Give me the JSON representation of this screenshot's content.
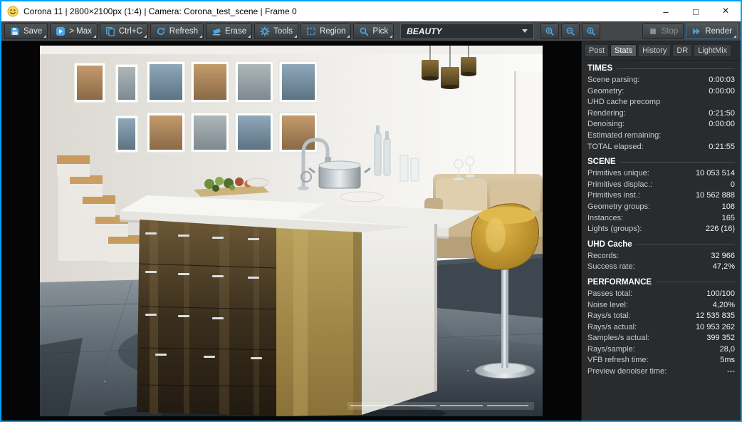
{
  "window": {
    "title": "Corona 11 | 2800×2100px (1:4) | Camera: Corona_test_scene | Frame 0",
    "controls": {
      "minimize": "–",
      "maximize": "□",
      "close": "×"
    }
  },
  "toolbar": {
    "buttons": [
      {
        "name": "save",
        "icon": "save-icon",
        "label": "Save",
        "dropdown": true
      },
      {
        "name": "to-max",
        "icon": "to-max-icon",
        "label": "> Max",
        "dropdown": true
      },
      {
        "name": "copy",
        "icon": "copy-icon",
        "label": "Ctrl+C",
        "dropdown": true
      },
      {
        "name": "refresh",
        "icon": "refresh-icon",
        "label": "Refresh",
        "dropdown": true
      },
      {
        "name": "erase",
        "icon": "erase-icon",
        "label": "Erase",
        "dropdown": true
      },
      {
        "name": "tools",
        "icon": "gear-icon",
        "label": "Tools",
        "dropdown": true
      },
      {
        "name": "region",
        "icon": "region-icon",
        "label": "Region",
        "dropdown": true
      },
      {
        "name": "pick",
        "icon": "pick-icon",
        "label": "Pick",
        "dropdown": true
      }
    ],
    "channel_select": {
      "value": "BEAUTY"
    },
    "zoom_buttons": [
      {
        "name": "zoom-in",
        "icon": "zoom-in-icon"
      },
      {
        "name": "zoom-out",
        "icon": "zoom-out-icon"
      },
      {
        "name": "zoom-reset",
        "icon": "zoom-reset-icon"
      }
    ],
    "stop": {
      "label": "Stop"
    },
    "render": {
      "label": "Render"
    }
  },
  "side_panel": {
    "tabs": [
      "Post",
      "Stats",
      "History",
      "DR",
      "LightMix"
    ],
    "active_tab": "Stats",
    "stats_sections": [
      {
        "title": "TIMES",
        "rows": [
          {
            "label": "Scene parsing:",
            "value": "0:00:03"
          },
          {
            "label": "Geometry:",
            "value": "0:00:00"
          },
          {
            "label": "UHD cache precomp",
            "value": ""
          },
          {
            "label": "Rendering:",
            "value": "0:21:50"
          },
          {
            "label": "Denoising:",
            "value": "0:00:00"
          },
          {
            "label": "Estimated remaining:",
            "value": ""
          },
          {
            "label": "TOTAL elapsed:",
            "value": "0:21:55"
          }
        ]
      },
      {
        "title": "SCENE",
        "rows": [
          {
            "label": "Primitives unique:",
            "value": "10 053 514"
          },
          {
            "label": "Primitives displac.:",
            "value": "0"
          },
          {
            "label": "Primitives inst.:",
            "value": "10 562 888"
          },
          {
            "label": "Geometry groups:",
            "value": "108"
          },
          {
            "label": "Instances:",
            "value": "165"
          },
          {
            "label": "Lights (groups):",
            "value": "226 (16)"
          }
        ]
      },
      {
        "title": "UHD Cache",
        "rows": [
          {
            "label": "Records:",
            "value": "32 966"
          },
          {
            "label": "Success rate:",
            "value": "47,2%"
          }
        ]
      },
      {
        "title": "PERFORMANCE",
        "rows": [
          {
            "label": "Passes total:",
            "value": "100/100"
          },
          {
            "label": "Noise level:",
            "value": "4,20%"
          },
          {
            "label": "Rays/s total:",
            "value": "12 535 835"
          },
          {
            "label": "Rays/s actual:",
            "value": "10 953 262"
          },
          {
            "label": "Samples/s actual:",
            "value": "399 352"
          },
          {
            "label": "Rays/sample:",
            "value": "28,0"
          },
          {
            "label": "VFB refresh time:",
            "value": "5ms"
          },
          {
            "label": "Preview denoiser time:",
            "value": "---"
          }
        ]
      }
    ]
  },
  "colors": {
    "window_border": "#00a0ff",
    "icon_blue": "#4aa8e8",
    "panel_bg": "#292b2d"
  }
}
